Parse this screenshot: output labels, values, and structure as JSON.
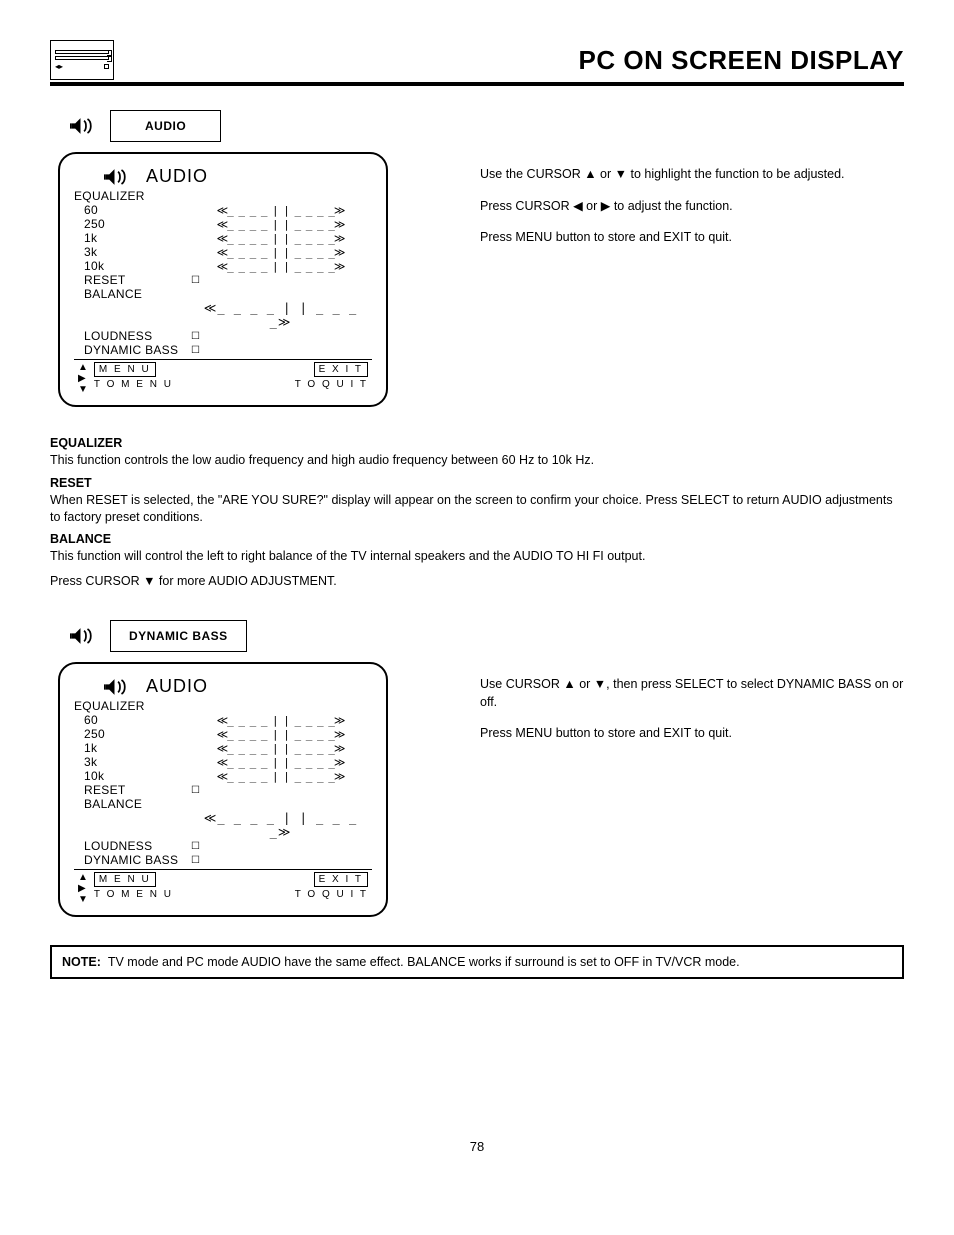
{
  "header": {
    "title": "PC ON SCREEN DISPLAY"
  },
  "page_number": "78",
  "section1": {
    "tag": "AUDIO",
    "instructions": [
      "Use the CURSOR ▲ or ▼ to highlight the function to be adjusted.",
      "Press CURSOR ◀ or ▶ to adjust the function.",
      "Press MENU button to store and EXIT to quit."
    ],
    "osd": {
      "title": "AUDIO",
      "section_label": "EQUALIZER",
      "eq_bands": [
        "60",
        "250",
        "1k",
        "3k",
        "10k"
      ],
      "items_after": [
        "RESET",
        "BALANCE"
      ],
      "bottom_items": [
        "LOUDNESS",
        "DYNAMIC BASS"
      ],
      "slider": "≪_ _ _ _ | | _ _ _ _≫",
      "slider_wide": "≪_ _ _ _ | | _ _ _ _≫",
      "checkbox": "☐",
      "footer": {
        "menu_box": "M E N U",
        "menu_sub": "T O  M E N U",
        "exit_box": "E X I T",
        "exit_sub": "T O   Q U I T"
      }
    }
  },
  "definitions": [
    {
      "head": "EQUALIZER",
      "body": "This function controls the low audio frequency and high audio frequency between 60 Hz to 10k Hz."
    },
    {
      "head": "RESET",
      "body": "When RESET is selected, the \"ARE YOU SURE?\" display will appear on the screen to confirm your choice. Press SELECT to return AUDIO adjustments to factory preset conditions."
    },
    {
      "head": "BALANCE",
      "body": "This function will control the left to right balance of the TV internal speakers and the AUDIO TO HI FI output."
    }
  ],
  "extra_line": "Press CURSOR ▼ for more AUDIO ADJUSTMENT.",
  "section2": {
    "tag": "DYNAMIC BASS",
    "instructions": [
      "Use CURSOR ▲ or ▼, then press SELECT to select DYNAMIC BASS on or off.",
      "Press MENU button to store and EXIT to quit."
    ]
  },
  "note": {
    "label": "NOTE:",
    "text": "TV mode and PC mode AUDIO have the same effect.  BALANCE works if surround is set to OFF in TV/VCR mode."
  }
}
